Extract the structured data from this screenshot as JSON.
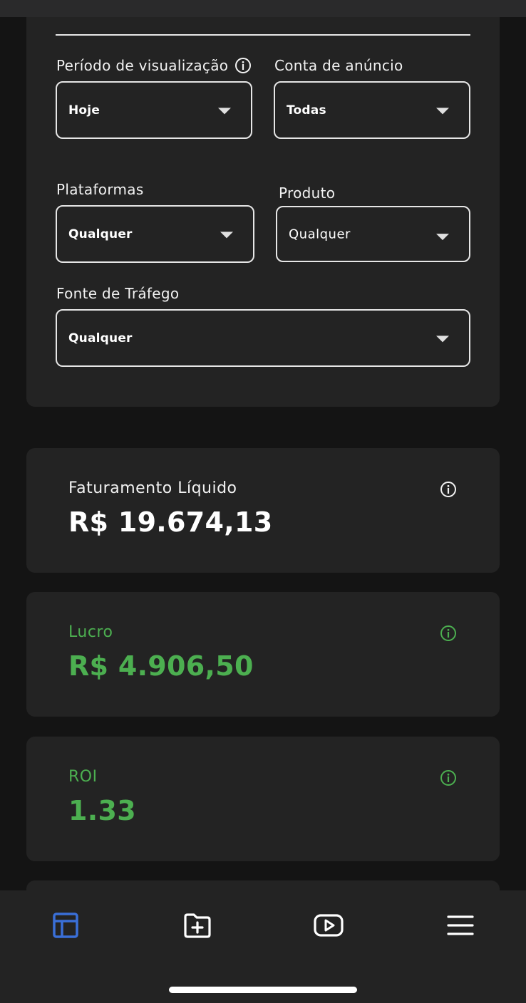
{
  "filters": {
    "periodo": {
      "label": "Período de visualização",
      "value": "Hoje"
    },
    "conta": {
      "label": "Conta de anúncio",
      "value": "Todas"
    },
    "plataformas": {
      "label": "Plataformas",
      "value": "Qualquer"
    },
    "produto": {
      "label": "Produto",
      "value": "Qualquer"
    },
    "fonte": {
      "label": "Fonte de Tráfego",
      "value": "Qualquer"
    }
  },
  "metrics": {
    "faturamento": {
      "label": "Faturamento Líquido",
      "value": "R$ 19.674,13"
    },
    "lucro": {
      "label": "Lucro",
      "value": "R$ 4.906,50"
    },
    "roi": {
      "label": "ROI",
      "value": "1.33"
    }
  },
  "colors": {
    "accent_green": "#4caf50",
    "accent_blue": "#3a6fd8",
    "background": "#141414",
    "card": "#232323"
  },
  "nav": {
    "items": [
      {
        "icon": "dashboard-icon",
        "active": true
      },
      {
        "icon": "folder-add-icon",
        "active": false
      },
      {
        "icon": "video-play-icon",
        "active": false
      },
      {
        "icon": "menu-icon",
        "active": false
      }
    ]
  }
}
